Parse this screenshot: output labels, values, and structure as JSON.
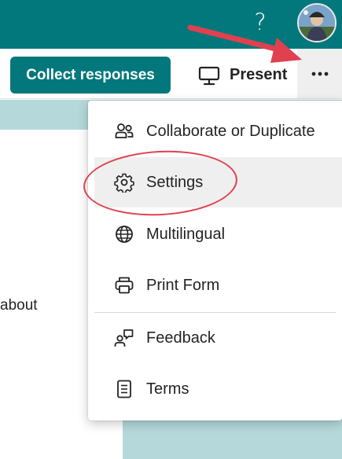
{
  "header": {
    "help_label": "?",
    "avatar_name": "avatar"
  },
  "toolbar": {
    "collect_label": "Collect responses",
    "present_label": "Present",
    "more_label": "More options"
  },
  "background": {
    "partial_text": "about"
  },
  "menu": {
    "items": [
      {
        "label": "Collaborate or Duplicate",
        "icon": "people-icon"
      },
      {
        "label": "Settings",
        "icon": "gear-icon"
      },
      {
        "label": "Multilingual",
        "icon": "globe-icon"
      },
      {
        "label": "Print Form",
        "icon": "printer-icon"
      },
      {
        "label": "Feedback",
        "icon": "feedback-icon"
      },
      {
        "label": "Terms",
        "icon": "document-icon"
      }
    ]
  },
  "colors": {
    "brand": "#03787c",
    "banner": "#b5d9da",
    "annotation": "#e0414f"
  }
}
